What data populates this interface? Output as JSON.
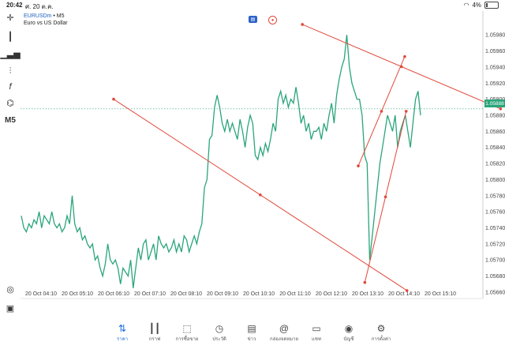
{
  "status": {
    "time": "20:42",
    "date": "ศ. 20 ต.ค.",
    "battery": "4%"
  },
  "symbol": {
    "name": "EURUSDm",
    "timeframe": "M5",
    "description": "Euro vs US Dollar"
  },
  "toolbar": {
    "timeframe": "M5"
  },
  "current_price": "1.05888",
  "colors": {
    "series": "#2aa57a",
    "trendline": "#e0483a",
    "accent": "#1d6ee0"
  },
  "chart_data": {
    "type": "line",
    "y_ticks": [
      "1.05980",
      "1.05960",
      "1.05940",
      "1.05920",
      "1.05900",
      "1.05880",
      "1.05860",
      "1.05840",
      "1.05820",
      "1.05800",
      "1.05780",
      "1.05760",
      "1.05740",
      "1.05720",
      "1.05700",
      "1.05680",
      "1.05660"
    ],
    "x_ticks": [
      "20 Oct 04:10",
      "20 Oct 05:10",
      "20 Oct 06:10",
      "20 Oct 07:10",
      "20 Oct 08:10",
      "20 Oct 09:10",
      "20 Oct 10:10",
      "20 Oct 11:10",
      "20 Oct 12:10",
      "20 Oct 13:10",
      "20 Oct 14:10",
      "20 Oct 15:10"
    ],
    "ylim": [
      1.0565,
      1.0599
    ],
    "current": 1.05888,
    "values": [
      1.05755,
      1.0574,
      1.05735,
      1.05745,
      1.0574,
      1.0575,
      1.05745,
      1.0576,
      1.0574,
      1.05755,
      1.0575,
      1.05745,
      1.0576,
      1.05745,
      1.0574,
      1.05745,
      1.05735,
      1.0574,
      1.05755,
      1.05745,
      1.0578,
      1.05745,
      1.05735,
      1.0574,
      1.05725,
      1.0573,
      1.0572,
      1.05715,
      1.0572,
      1.057,
      1.05705,
      1.0569,
      1.0568,
      1.05695,
      1.0572,
      1.057,
      1.05695,
      1.057,
      1.0569,
      1.0567,
      1.0569,
      1.05685,
      1.0568,
      1.057,
      1.05665,
      1.0569,
      1.05715,
      1.057,
      1.0572,
      1.05725,
      1.057,
      1.0571,
      1.0572,
      1.057,
      1.0573,
      1.0572,
      1.05715,
      1.0572,
      1.0571,
      1.05715,
      1.05725,
      1.0571,
      1.0572,
      1.0571,
      1.0573,
      1.05725,
      1.0571,
      1.0572,
      1.0573,
      1.0572,
      1.05735,
      1.05745,
      1.0579,
      1.058,
      1.0585,
      1.05855,
      1.0589,
      1.05905,
      1.0589,
      1.0587,
      1.0586,
      1.05875,
      1.0586,
      1.0587,
      1.0586,
      1.0585,
      1.05875,
      1.0586,
      1.0584,
      1.05865,
      1.0588,
      1.0587,
      1.0583,
      1.05825,
      1.0584,
      1.0583,
      1.05845,
      1.05835,
      1.0585,
      1.0587,
      1.0586,
      1.059,
      1.0591,
      1.05895,
      1.05905,
      1.0589,
      1.059,
      1.05895,
      1.05915,
      1.05895,
      1.0587,
      1.0588,
      1.0586,
      1.0587,
      1.0585,
      1.0586,
      1.0586,
      1.05865,
      1.0585,
      1.0587,
      1.0586,
      1.0588,
      1.05895,
      1.0587,
      1.05905,
      1.05925,
      1.0594,
      1.0595,
      1.0598,
      1.0594,
      1.0592,
      1.0591,
      1.059,
      1.059,
      1.0588,
      1.0583,
      1.0582,
      1.057,
      1.0573,
      1.0576,
      1.0579,
      1.0582,
      1.0584,
      1.0586,
      1.0588,
      1.0587,
      1.0586,
      1.0588,
      1.0584,
      1.0586,
      1.0587,
      1.0588,
      1.0586,
      1.0584,
      1.0587,
      1.059,
      1.0591,
      1.0588
    ],
    "trendlines": [
      {
        "x1": 1.0,
        "y1": 1.059,
        "x2": 5.04,
        "y2": 1.05662
      },
      {
        "x1": 3.6,
        "y1": 1.05993,
        "x2": 6.33,
        "y2": 1.05888
      },
      {
        "x1": 4.37,
        "y1": 1.05817,
        "x2": 5.01,
        "y2": 1.05953
      },
      {
        "x1": 4.46,
        "y1": 1.05672,
        "x2": 5.03,
        "y2": 1.05885
      }
    ]
  },
  "tabs": [
    {
      "label": "ราคา",
      "icon": "quotes-icon"
    },
    {
      "label": "กราฟ",
      "icon": "chart-icon"
    },
    {
      "label": "การซื้อขาย",
      "icon": "trade-icon"
    },
    {
      "label": "ประวัติ",
      "icon": "history-icon"
    },
    {
      "label": "ข่าว",
      "icon": "news-icon"
    },
    {
      "label": "กล่องจดหมาย",
      "icon": "mailbox-icon"
    },
    {
      "label": "แชท",
      "icon": "chat-icon"
    },
    {
      "label": "บัญชี",
      "icon": "account-icon"
    },
    {
      "label": "การตั้งค่า",
      "icon": "settings-icon"
    }
  ]
}
